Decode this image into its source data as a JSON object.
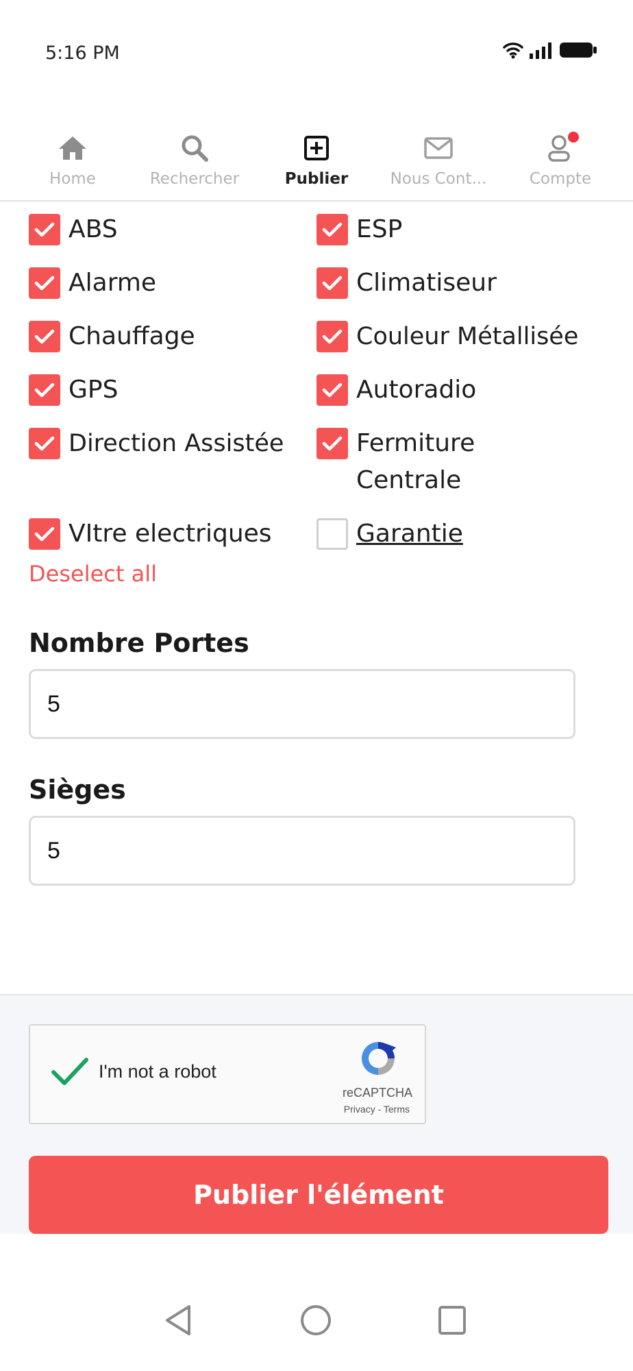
{
  "status_bar": {
    "time": "5:16 PM"
  },
  "nav": {
    "items": [
      {
        "label": "Home",
        "icon": "home-icon"
      },
      {
        "label": "Rechercher",
        "icon": "search-icon"
      },
      {
        "label": "Publier",
        "icon": "plus-square-icon",
        "active": true
      },
      {
        "label": "Nous Cont...",
        "icon": "mail-icon"
      },
      {
        "label": "Compte",
        "icon": "user-icon",
        "notification": true
      }
    ]
  },
  "features": [
    {
      "label": "ABS",
      "checked": true
    },
    {
      "label": "ESP",
      "checked": true
    },
    {
      "label": "Alarme",
      "checked": true
    },
    {
      "label": "Climatiseur",
      "checked": true
    },
    {
      "label": "Chauffage",
      "checked": true
    },
    {
      "label": "Couleur Métallisée",
      "checked": true
    },
    {
      "label": "GPS",
      "checked": true
    },
    {
      "label": "Autoradio",
      "checked": true
    },
    {
      "label": "Direction Assistée",
      "checked": true
    },
    {
      "label": "Fermiture",
      "label_line2": "Centrale",
      "checked": true
    },
    {
      "label": "VItre electriques",
      "checked": true
    },
    {
      "label": "Garantie",
      "checked": false
    }
  ],
  "deselect_all": "Deselect all",
  "fields": {
    "doors": {
      "label": "Nombre Portes",
      "value": "5"
    },
    "seats": {
      "label": "Sièges",
      "value": "5"
    }
  },
  "recaptcha": {
    "text": "I'm not a robot",
    "brand": "reCAPTCHA",
    "links": "Privacy - Terms",
    "checked": true
  },
  "publish_button": "Publier l'élément",
  "colors": {
    "accent": "#f45454",
    "notification": "#f0333e",
    "recaptcha_check": "#1aa260"
  }
}
